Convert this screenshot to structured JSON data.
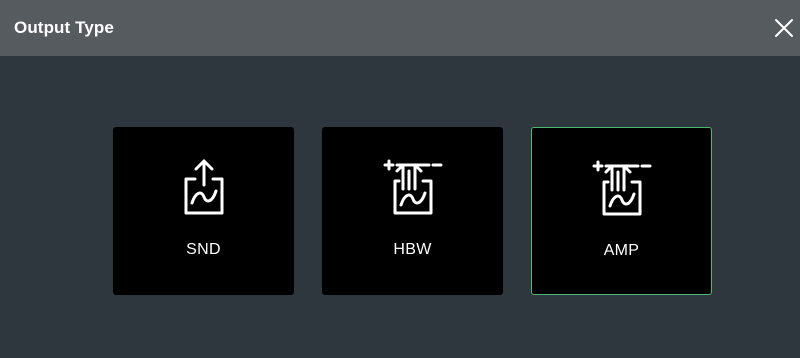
{
  "dialog": {
    "title": "Output Type"
  },
  "options": [
    {
      "label": "SND",
      "icon": "send-upload-icon",
      "selected": false
    },
    {
      "label": "HBW",
      "icon": "hbw-in-out-icon",
      "selected": false
    },
    {
      "label": "AMP",
      "icon": "amp-in-out-icon",
      "selected": true
    }
  ],
  "colors": {
    "title_bar": "#555b5f",
    "background": "#2f373e",
    "card": "#000000",
    "selected_border": "#4fb870",
    "text": "#ffffff"
  }
}
